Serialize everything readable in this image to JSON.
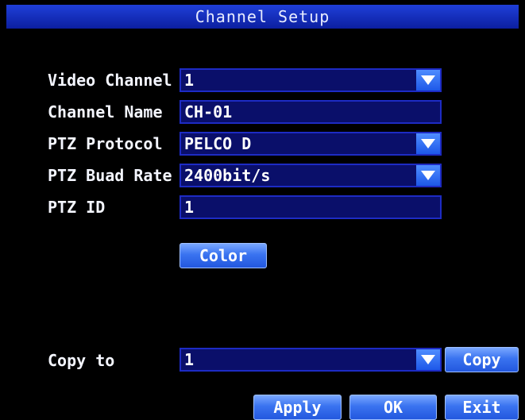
{
  "title": "Channel Setup",
  "fields": {
    "video_channel": {
      "label": "Video Channel",
      "value": "1"
    },
    "channel_name": {
      "label": "Channel Name",
      "value": "CH-01"
    },
    "ptz_protocol": {
      "label": "PTZ Protocol",
      "value": "PELCO D"
    },
    "ptz_baud_rate": {
      "label": "PTZ Buad Rate",
      "value": "2400bit/s"
    },
    "ptz_id": {
      "label": "PTZ ID",
      "value": "1"
    }
  },
  "color_button": "Color",
  "copy_to": {
    "label": "Copy to",
    "value": "1",
    "button": "Copy"
  },
  "footer": {
    "apply": "Apply",
    "ok": "OK",
    "exit": "Exit"
  },
  "colors": {
    "title_bar": "#1f3fd8",
    "field_bg": "#0a0f6a",
    "button": "#3a73f0"
  },
  "icons": {
    "dropdown": "chevron-down-icon"
  }
}
